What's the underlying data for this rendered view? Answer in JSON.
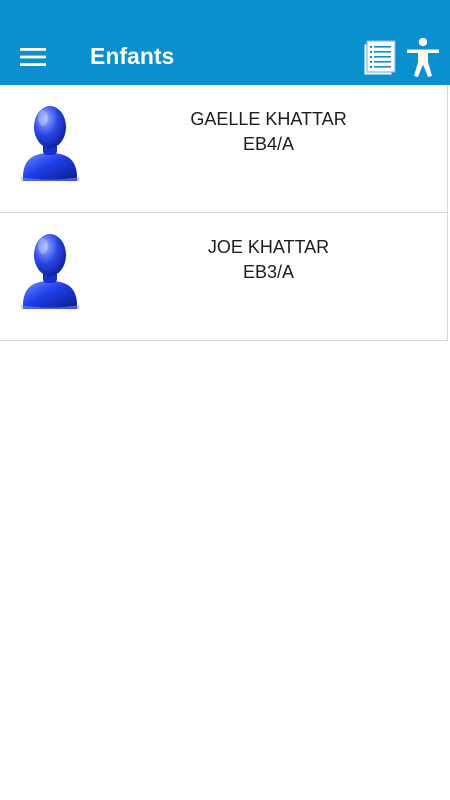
{
  "app_bar": {
    "title": "Enfants",
    "background_color": "#0a8fcf",
    "menu_icon": "hamburger-menu-icon",
    "actions": [
      {
        "icon": "document-icon"
      },
      {
        "icon": "accessibility-icon"
      }
    ]
  },
  "children": [
    {
      "name": "GAELLE KHATTAR",
      "class": "EB4/A",
      "avatar_icon": "user-avatar-icon"
    },
    {
      "name": "JOE KHATTAR",
      "class": "EB3/A",
      "avatar_icon": "user-avatar-icon"
    }
  ]
}
